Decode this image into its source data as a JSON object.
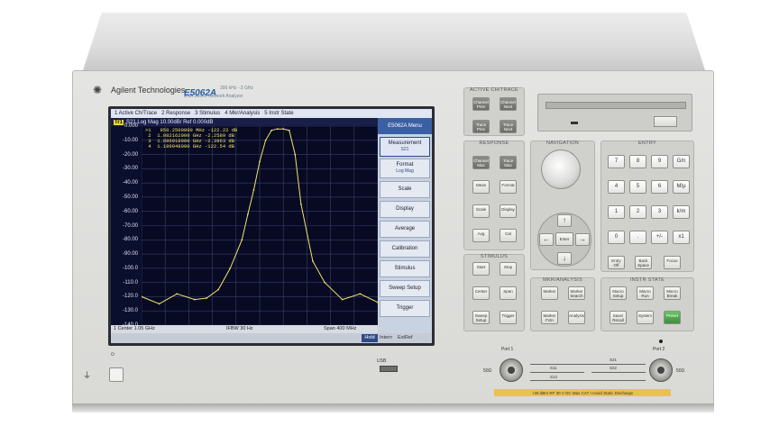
{
  "brand": {
    "logo_icon": "spark-logo-icon",
    "name": "Agilent Technologies"
  },
  "model": {
    "name": "E5062A",
    "range": "300 kHz - 3 GHz",
    "desc": "ENA Series Network Analyzer"
  },
  "screen": {
    "tabs": [
      "1 Active Ch/Trace",
      "2 Response",
      "3 Stimulus",
      "4 Mkr/Analysis",
      "5 Instr State"
    ],
    "trace_badge": "Tr1",
    "trace_title": "S21 Log Mag 10.00dB/ Ref 0.000dB",
    "marker_readouts": [
      ">1   950.2500000 MHz -122.22 dB",
      " 2  1.082162000 GHz -2.2589 dB",
      " 3  1.096918000 GHz -2.3963 dB",
      " 4  1.189948000 GHz -122.54 dB"
    ],
    "y_labels": [
      "0.000",
      "-10.00",
      "-20.00",
      "-30.00",
      "-40.00",
      "-50.00",
      "-60.00",
      "-70.00",
      "-80.00",
      "-90.00",
      "-100.0",
      "-110.0",
      "-120.0",
      "-130.0",
      "-140.0"
    ],
    "status": {
      "center": "1  Center 1.05 GHz",
      "ifbw": "IFBW 30 Hz",
      "span": "Span 400 MHz"
    },
    "bottom": {
      "hold": "Hold",
      "int": "Intern",
      "ext": "ExtRef"
    },
    "menu": {
      "title": "E5062A Menu",
      "items": [
        {
          "label": "Measurement",
          "sub": "S21"
        },
        {
          "label": "Format",
          "sub": "Log Mag"
        },
        {
          "label": "Scale",
          "sub": ""
        },
        {
          "label": "Display",
          "sub": ""
        },
        {
          "label": "Average",
          "sub": ""
        },
        {
          "label": "Calibration",
          "sub": ""
        },
        {
          "label": "Stimulus",
          "sub": ""
        },
        {
          "label": "Sweep Setup",
          "sub": ""
        },
        {
          "label": "Trigger",
          "sub": ""
        }
      ]
    },
    "trace_color": "#f2e26a"
  },
  "chart_data": {
    "type": "line",
    "title": "S21 Log Mag 10.00dB/ Ref 0.000dB",
    "ylim": [
      -140,
      0
    ],
    "xlim": [
      850,
      1250
    ],
    "x_unit": "MHz",
    "y_unit": "dB",
    "series": [
      {
        "x": [
          850,
          880,
          910,
          940,
          960,
          980,
          1000,
          1020,
          1030,
          1040,
          1050,
          1060,
          1070,
          1080,
          1090,
          1100,
          1110,
          1120,
          1140,
          1160,
          1190,
          1220,
          1250
        ],
        "values": [
          -120,
          -125,
          -118,
          -122,
          -121,
          -115,
          -100,
          -80,
          -62,
          -45,
          -25,
          -10,
          -3,
          -2,
          -2,
          -3,
          -20,
          -55,
          -95,
          -110,
          -122,
          -118,
          -124
        ]
      }
    ]
  },
  "panel": {
    "active_title": "ACTIVE CH/TRACE",
    "active_keys": [
      "Channel Prev",
      "Channel Next",
      "Trace Prev",
      "Trace Next"
    ],
    "response_title": "RESPONSE",
    "response_keys": [
      "Channel Max",
      "Trace Max",
      "Meas",
      "Format",
      "Scale",
      "Display",
      "Avg",
      "Cal"
    ],
    "navigation_title": "NAVIGATION",
    "enter_label": "Enter",
    "entry_title": "ENTRY",
    "entry_keys": [
      "7",
      "8",
      "9",
      "G/n",
      "4",
      "5",
      "6",
      "M/μ",
      "1",
      "2",
      "3",
      "k/m",
      "0",
      ".",
      "+/-",
      "x1"
    ],
    "entry_bottom": [
      "Entry Off",
      "Back Space",
      "Focus"
    ],
    "stimulus_title": "STIMULUS",
    "stimulus_keys": [
      "Start",
      "Stop",
      "Center",
      "Span",
      "Sweep Setup",
      "Trigger"
    ],
    "mkr_title": "MKR/ANALYSIS",
    "mkr_keys": [
      "Marker",
      "Marker Search",
      "Marker Fctn",
      "Analysis"
    ],
    "instr_title": "INSTR STATE",
    "instr_keys": [
      "Macro Setup",
      "Macro Run",
      "Macro Break",
      "Save/ Recall",
      "System",
      "Preset"
    ],
    "usb_label": "USB",
    "port1_label": "Port 1",
    "port2_label": "Port 2",
    "port_rating_left": "50Ω",
    "port_rating_right": "50Ω",
    "s_params": [
      "S21",
      "S11",
      "S22",
      "S12"
    ],
    "warning": "+26 dBm RF  30 V DC Max  CAT I   Avoid Static Discharge"
  }
}
